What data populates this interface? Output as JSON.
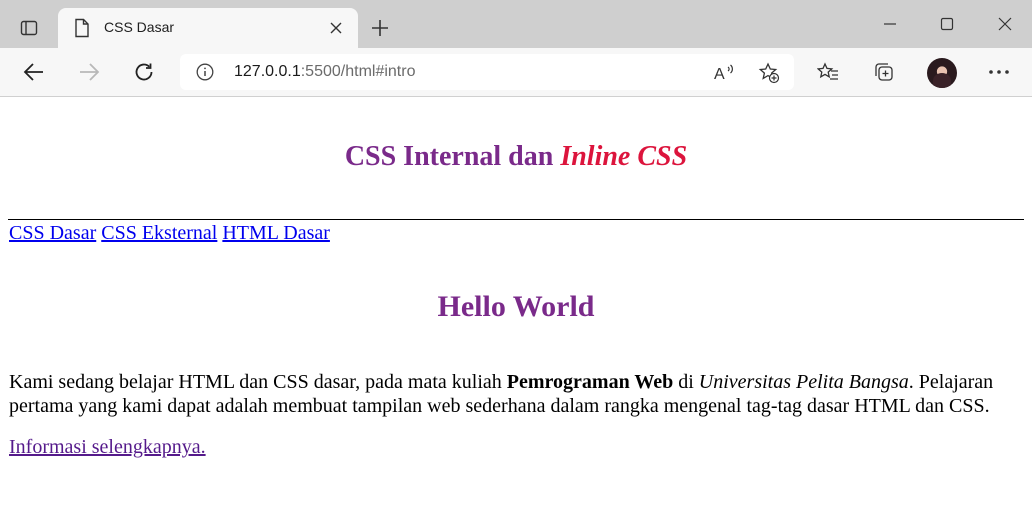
{
  "browser": {
    "tab_title": "CSS Dasar",
    "url_host": "127.0.0.1",
    "url_rest": ":5500/html#intro",
    "icons": {
      "tab_actions": "tab-actions-icon",
      "page": "page-icon",
      "close": "close-icon",
      "new_tab": "plus-icon",
      "back": "back-arrow-icon",
      "forward": "forward-arrow-icon",
      "refresh": "refresh-icon",
      "info": "info-icon",
      "read_aloud": "read-aloud-icon",
      "add_favorite": "add-favorite-icon",
      "favorites": "favorites-icon",
      "collections": "collections-icon",
      "more": "more-icon"
    }
  },
  "page": {
    "title_main": "CSS Internal dan ",
    "title_em": "Inline CSS",
    "nav": [
      "CSS Dasar",
      "CSS Eksternal",
      "HTML Dasar"
    ],
    "heading": "Hello World",
    "paragraph": {
      "part1": "Kami sedang belajar HTML dan CSS dasar, pada mata kuliah ",
      "bold": "Pemrograman Web",
      "part2": " di ",
      "italic": "Universitas Pelita Bangsa",
      "part3": ". Pelajaran pertama yang kami dapat adalah membuat tampilan web sederhana dalam rangka mengenal tag-tag dasar HTML dan CSS."
    },
    "more_link": "Informasi selengkapnya.",
    "colors": {
      "heading": "#7a2a8a",
      "emphasis": "#dc143c",
      "link": "#0000ee",
      "visited_link": "#551a8b"
    }
  }
}
